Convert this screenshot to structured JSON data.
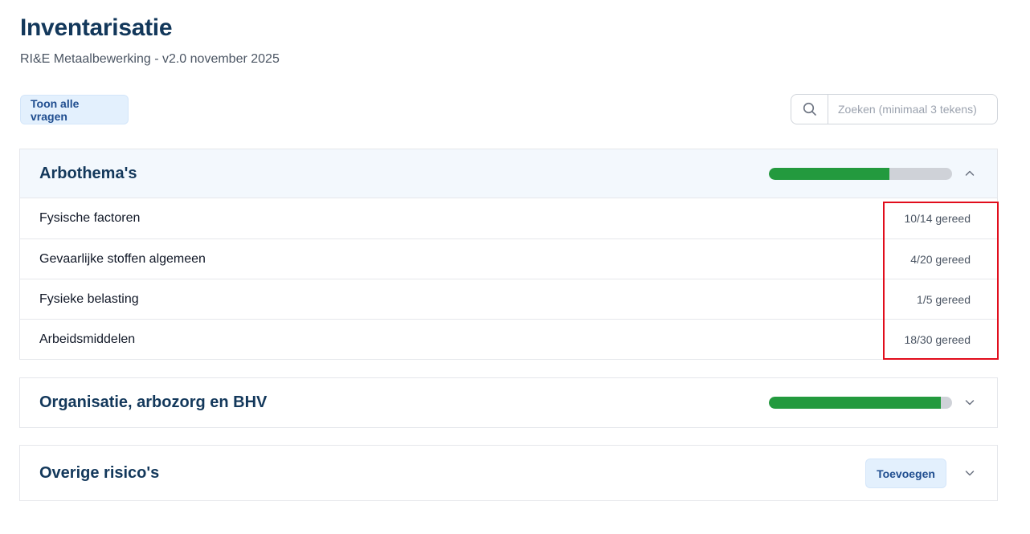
{
  "header": {
    "title": "Inventarisatie",
    "subtitle": "RI&E Metaalbewerking - v2.0 november 2025"
  },
  "toolbar": {
    "show_all_label": "Toon alle vragen",
    "search_placeholder": "Zoeken (minimaal 3 tekens)",
    "search_value": ""
  },
  "sections": [
    {
      "title": "Arbothema's",
      "expanded": true,
      "progress": 0.66,
      "items": [
        {
          "label": "Fysische factoren",
          "status": "10/14 gereed"
        },
        {
          "label": "Gevaarlijke stoffen algemeen",
          "status": "4/20 gereed"
        },
        {
          "label": "Fysieke belasting",
          "status": "1/5 gereed"
        },
        {
          "label": "Arbeidsmiddelen",
          "status": "18/30 gereed"
        }
      ]
    },
    {
      "title": "Organisatie, arbozorg en BHV",
      "expanded": false,
      "progress": 0.94
    },
    {
      "title": "Overige risico's",
      "expanded": false,
      "add_label": "Toevoegen"
    }
  ],
  "colors": {
    "accent": "#13385b",
    "progress": "#239a3e",
    "highlight": "#e10d1c"
  },
  "icons": {
    "search": "search-icon",
    "collapse": "chevron-up-icon",
    "expand": "chevron-down-icon"
  }
}
